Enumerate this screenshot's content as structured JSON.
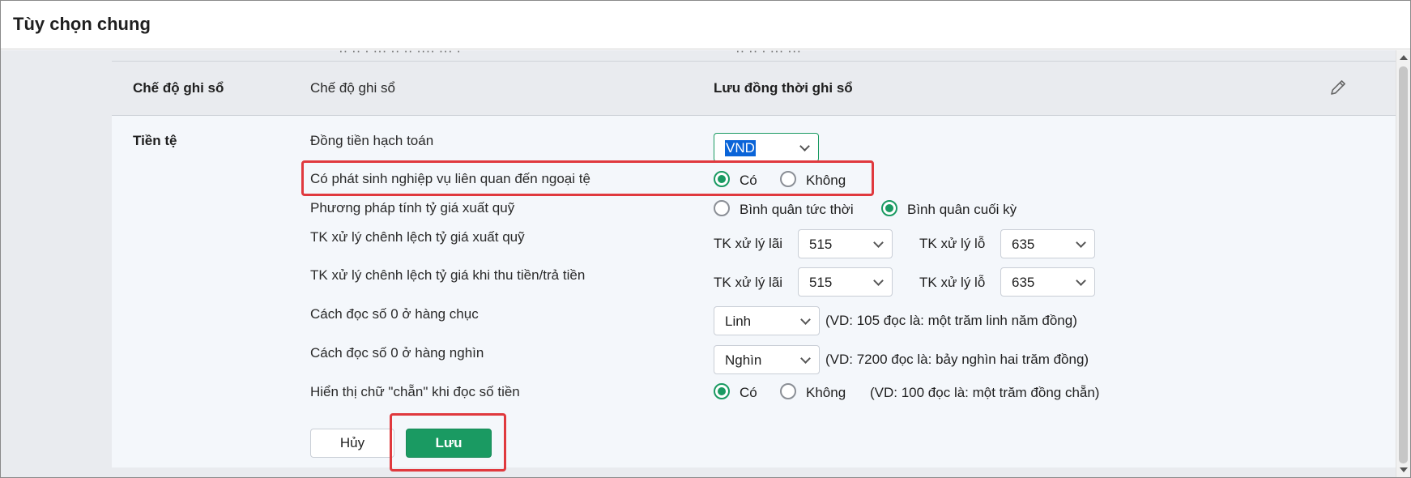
{
  "dialog": {
    "title": "Tùy chọn chung"
  },
  "mode_row": {
    "section": "Chế độ ghi sổ",
    "setting": "Chế độ ghi sổ",
    "value": "Lưu đồng thời ghi sổ"
  },
  "currency": {
    "section": "Tiền tệ",
    "accounting_currency": {
      "label": "Đồng tiền hạch toán",
      "value": "VND"
    },
    "foreign_currency": {
      "label": "Có phát sinh nghiệp vụ liên quan đến ngoại tệ",
      "yes": "Có",
      "no": "Không",
      "selected": "yes"
    },
    "rate_method": {
      "label": "Phương pháp tính tỷ giá xuất quỹ",
      "option1": "Bình quân tức thời",
      "option2": "Bình quân cuối kỳ",
      "selected": "option2"
    },
    "diff_out": {
      "label": "TK xử lý chênh lệch tỷ giá xuất quỹ",
      "gain_label": "TK xử lý lãi",
      "gain_value": "515",
      "loss_label": "TK xử lý lỗ",
      "loss_value": "635"
    },
    "diff_pay": {
      "label": "TK xử lý chênh lệch tỷ giá khi thu tiền/trả tiền",
      "gain_label": "TK xử lý lãi",
      "gain_value": "515",
      "loss_label": "TK xử lý lỗ",
      "loss_value": "635"
    },
    "zero_tens": {
      "label": "Cách đọc số 0 ở hàng chục",
      "value": "Linh",
      "example": "(VD: 105 đọc là: một trăm linh năm đồng)"
    },
    "zero_thousands": {
      "label": "Cách đọc số 0 ở hàng nghìn",
      "value": "Nghìn",
      "example": "(VD: 7200 đọc là: bảy nghìn hai trăm đồng)"
    },
    "even_word": {
      "label": "Hiển thị chữ \"chẵn\" khi đọc số tiền",
      "yes": "Có",
      "no": "Không",
      "selected": "yes",
      "example": "(VD: 100 đọc là: một trăm đồng chẵn)"
    }
  },
  "actions": {
    "cancel": "Hủy",
    "save": "Lưu"
  },
  "colors": {
    "accent": "#1a9a62",
    "highlight": "#e0393e"
  }
}
